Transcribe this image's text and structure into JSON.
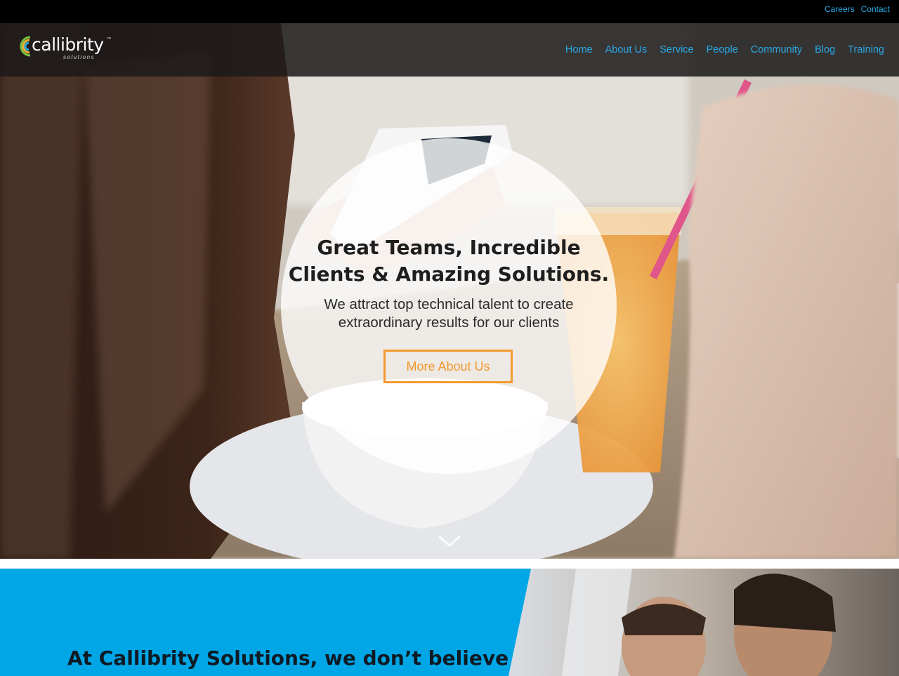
{
  "topbar": {
    "links": [
      "Careers",
      "Contact"
    ]
  },
  "brand": {
    "name": "callibrity",
    "tagline": "solutions",
    "trademark": "™"
  },
  "nav": {
    "items": [
      "Home",
      "About Us",
      "Service",
      "People",
      "Community",
      "Blog",
      "Training"
    ]
  },
  "hero": {
    "title": "Great Teams, Incredible Clients & Amazing Solutions.",
    "subtitle": "We attract top technical talent to create extraordinary results for our clients",
    "cta_label": "More About Us"
  },
  "intro": {
    "headline": "At Callibrity Solutions, we don’t believe"
  },
  "colors": {
    "accent_blue": "#2aa7e4",
    "section_blue": "#00a6e6",
    "cta_orange": "#f29a2e",
    "navbar": "#1c1a1a"
  },
  "icons": {
    "scroll": "chevron-down-icon",
    "logo": "callibrity-logo-icon"
  }
}
